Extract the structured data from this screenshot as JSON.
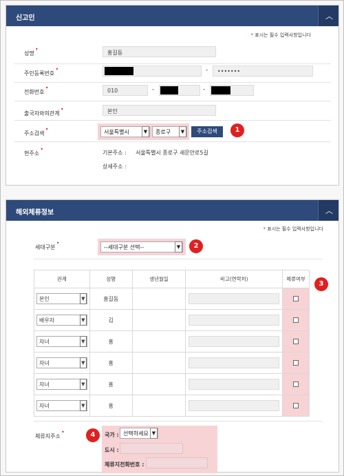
{
  "reporter": {
    "title": "신고인",
    "required_note": "표시는 필수 입력사항입니다",
    "name_label": "성명",
    "name_value": "홍길동",
    "rrn_label": "주민등록번호",
    "rrn_back": "•••••••",
    "phone_label": "전화번호",
    "phone_prefix": "010",
    "relation_label": "출국자와의관계",
    "relation_value": "본인",
    "address_search_label": "주소검색",
    "city_select": "서울특별시",
    "district_select": "종로구",
    "search_button": "주소검색",
    "current_address_label": "현주소",
    "basic_address_label": "기본주소 :",
    "basic_address_value": "서울특별시 종로구 새문안로5길",
    "detail_address_label": "상세주소 :"
  },
  "overseas": {
    "title": "해외체류정보",
    "required_note": "표시는 필수 입력사항입니다",
    "household_label": "세대구분",
    "household_select": "--세대구분 선택--",
    "columns": [
      "관계",
      "성명",
      "생년월일",
      "비고(연락처)",
      "체류여부"
    ],
    "rows": [
      {
        "relation": "본인",
        "name": "홍길동"
      },
      {
        "relation": "배우자",
        "name": "김"
      },
      {
        "relation": "자녀",
        "name": "홍"
      },
      {
        "relation": "자녀",
        "name": "홍"
      },
      {
        "relation": "자녀",
        "name": "홍"
      },
      {
        "relation": "자녀",
        "name": "홍"
      }
    ],
    "stay_address_label": "체류지주소",
    "country_label": "국가 :",
    "country_select": "선택하세요",
    "city_label": "도시 :",
    "stay_phone_label": "체류지전화번호 :"
  },
  "badges": [
    "1",
    "2",
    "3",
    "4"
  ],
  "icons": {
    "collapse": "chevron-up-icon",
    "dropdown": "chevron-down-icon"
  },
  "colors": {
    "header": "#2e4a7a",
    "highlight": "#f7d3d6",
    "badge": "#e02020",
    "required": "#d9262d"
  }
}
